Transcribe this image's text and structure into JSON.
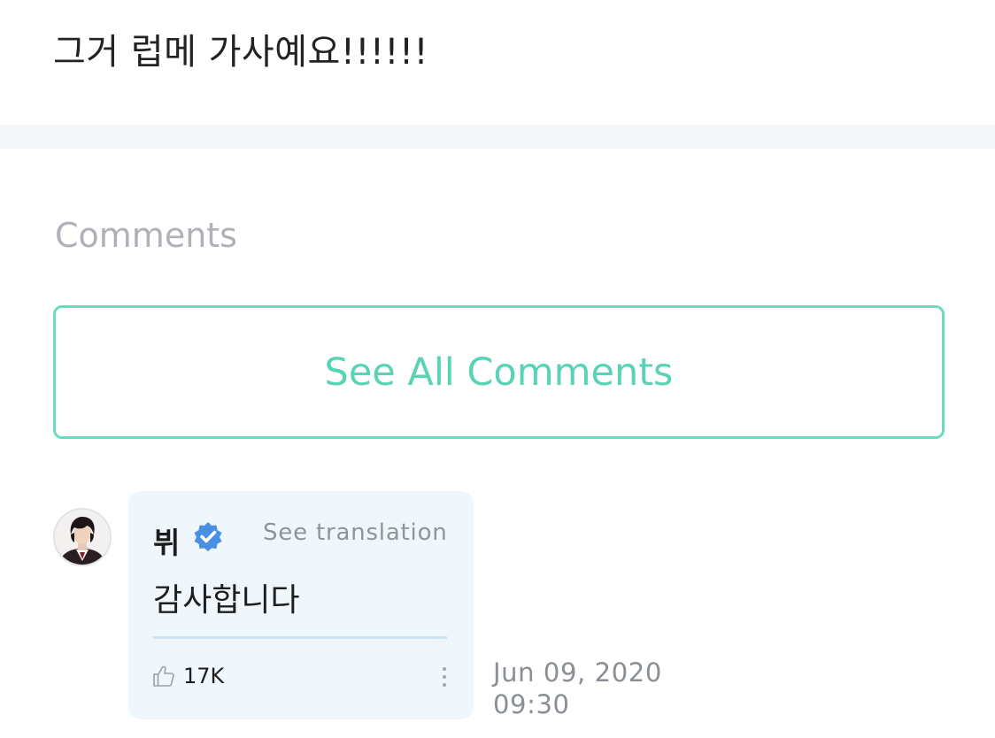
{
  "post": {
    "text": "그거 럽메 가사예요!!!!!!"
  },
  "comments_section": {
    "heading": "Comments",
    "see_all_label": "See All Comments"
  },
  "comment": {
    "username": "뷔",
    "verified": true,
    "see_translation_label": "See translation",
    "body": "감사합니다",
    "like_count": "17K",
    "date": "Jun 09, 2020",
    "time": "09:30"
  },
  "icons": {
    "verified": "verified-badge-icon",
    "like": "thumbs-up-icon",
    "more": "more-vertical-icon"
  },
  "colors": {
    "accent": "#58d3b5",
    "accent_border": "#6bdbc2",
    "verified": "#4a90e2",
    "bubble_bg": "#f0f7fc",
    "band_bg": "#f4f6f8",
    "muted_text": "#aeb2b8"
  }
}
